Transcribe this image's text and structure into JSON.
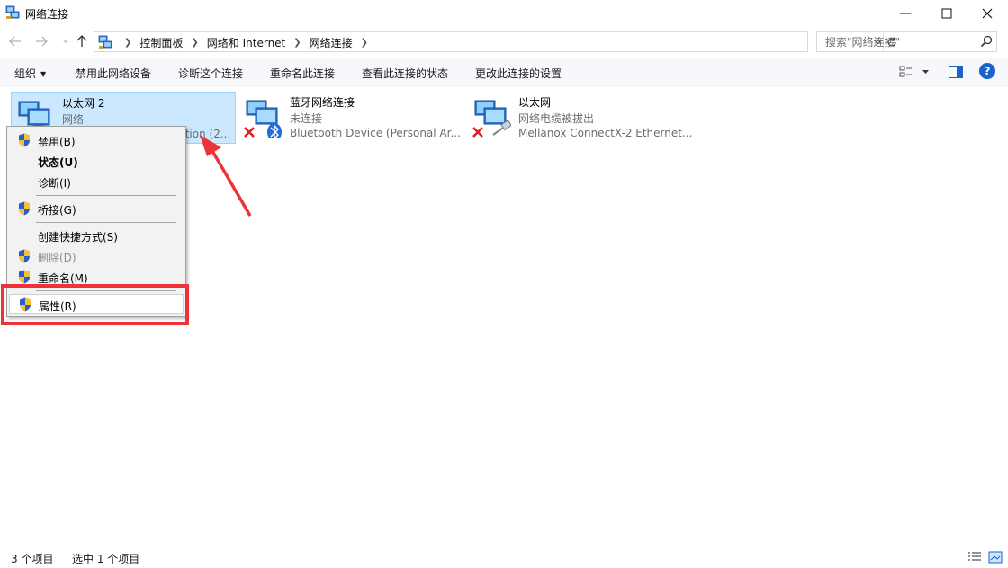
{
  "window": {
    "title": "网络连接",
    "minimize_glyph": "—",
    "maximize_glyph": "☐",
    "close_glyph": "✕"
  },
  "address_bar": {
    "breadcrumbs": [
      "控制面板",
      "网络和 Internet",
      "网络连接"
    ],
    "search_placeholder": "搜索\"网络连接\""
  },
  "command_bar": {
    "organize": "组织",
    "disable_device": "禁用此网络设备",
    "diagnose": "诊断这个连接",
    "rename": "重命名此连接",
    "view_status": "查看此连接的状态",
    "change_settings": "更改此连接的设置",
    "help_label": "?"
  },
  "connections": [
    {
      "name": "以太网 2",
      "status": "网络",
      "device": "ttion (2...",
      "selected": true,
      "disconnected": false
    },
    {
      "name": "蓝牙网络连接",
      "status": "未连接",
      "device": "Bluetooth Device (Personal Ar...",
      "selected": false,
      "disconnected": true
    },
    {
      "name": "以太网",
      "status": "网络电缆被拔出",
      "device": "Mellanox ConnectX-2 Ethernet...",
      "selected": false,
      "disconnected": true
    }
  ],
  "context_menu": {
    "items": [
      {
        "label": "禁用(B)",
        "shield": true,
        "bold": false,
        "disabled": false
      },
      {
        "label": "状态(U)",
        "shield": false,
        "bold": true,
        "disabled": false
      },
      {
        "label": "诊断(I)",
        "shield": false,
        "bold": false,
        "disabled": false
      },
      {
        "label": "桥接(G)",
        "shield": true,
        "bold": false,
        "disabled": false
      },
      {
        "label": "创建快捷方式(S)",
        "shield": false,
        "bold": false,
        "disabled": false
      },
      {
        "label": "删除(D)",
        "shield": true,
        "bold": false,
        "disabled": true
      },
      {
        "label": "重命名(M)",
        "shield": true,
        "bold": false,
        "disabled": false
      },
      {
        "label": "属性(R)",
        "shield": true,
        "bold": false,
        "disabled": false,
        "highlighted": true
      }
    ]
  },
  "status_bar": {
    "item_count": "3 个项目",
    "selected_count": "选中 1 个项目"
  },
  "colors": {
    "selection_bg": "#cce8ff",
    "selection_border": "#99d1ff",
    "annotation_red": "#ee3338",
    "help_blue": "#1a63c8"
  }
}
